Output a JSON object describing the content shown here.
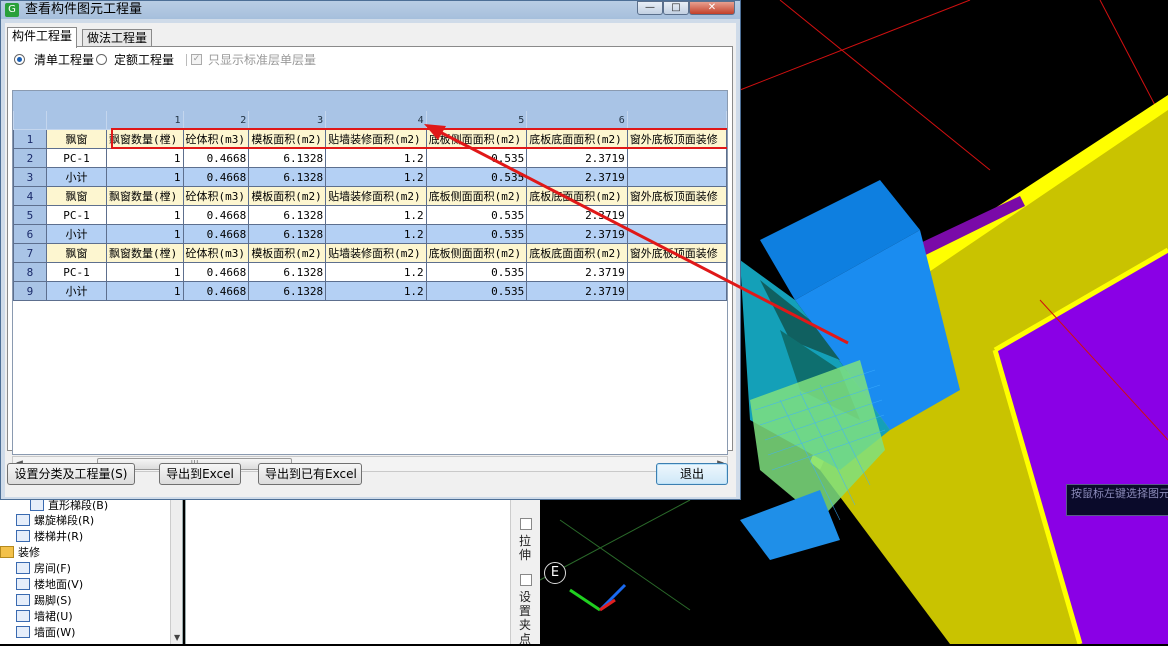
{
  "dialog": {
    "title": "查看构件图元工程量",
    "tabs": [
      {
        "label": "构件工程量",
        "active": true
      },
      {
        "label": "做法工程量",
        "active": false
      }
    ],
    "options": {
      "radio_list": "清单工程量",
      "radio_quota": "定额工程量",
      "check_std_floor": "只显示标准层单层量",
      "selected": "清单工程量"
    },
    "grid": {
      "column_numbers": [
        "1",
        "2",
        "3",
        "4",
        "5",
        "6"
      ],
      "rows": [
        {
          "num": "1",
          "style": "cream",
          "cells": [
            "飘窗",
            "飘窗数量(樘)",
            "砼体积(m3)",
            "模板面积(m2)",
            "贴墙装修面积(m2)",
            "底板侧面面积(m2)",
            "底板底面面积(m2)",
            "窗外底板顶面装修"
          ]
        },
        {
          "num": "2",
          "style": "white",
          "cells": [
            "PC-1",
            "1",
            "0.4668",
            "6.1328",
            "1.2",
            "0.535",
            "2.3719",
            ""
          ]
        },
        {
          "num": "3",
          "style": "blue",
          "cells": [
            "小计",
            "1",
            "0.4668",
            "6.1328",
            "1.2",
            "0.535",
            "2.3719",
            ""
          ]
        },
        {
          "num": "4",
          "style": "cream",
          "cells": [
            "飘窗",
            "飘窗数量(樘)",
            "砼体积(m3)",
            "模板面积(m2)",
            "贴墙装修面积(m2)",
            "底板侧面面积(m2)",
            "底板底面面积(m2)",
            "窗外底板顶面装修"
          ]
        },
        {
          "num": "5",
          "style": "white",
          "cells": [
            "PC-1",
            "1",
            "0.4668",
            "6.1328",
            "1.2",
            "0.535",
            "2.3719",
            ""
          ]
        },
        {
          "num": "6",
          "style": "blue",
          "cells": [
            "小计",
            "1",
            "0.4668",
            "6.1328",
            "1.2",
            "0.535",
            "2.3719",
            ""
          ]
        },
        {
          "num": "7",
          "style": "cream",
          "cells": [
            "飘窗",
            "飘窗数量(樘)",
            "砼体积(m3)",
            "模板面积(m2)",
            "贴墙装修面积(m2)",
            "底板侧面面积(m2)",
            "底板底面面积(m2)",
            "窗外底板顶面装修"
          ]
        },
        {
          "num": "8",
          "style": "white",
          "cells": [
            "PC-1",
            "1",
            "0.4668",
            "6.1328",
            "1.2",
            "0.535",
            "2.3719",
            ""
          ]
        },
        {
          "num": "9",
          "style": "blue",
          "cells": [
            "小计",
            "1",
            "0.4668",
            "6.1328",
            "1.2",
            "0.535",
            "2.3719",
            ""
          ]
        }
      ]
    },
    "buttons": {
      "set_category": "设置分类及工程量(S)",
      "export_excel": "导出到Excel",
      "export_existing": "导出到已有Excel",
      "exit": "退出"
    },
    "window_buttons": {
      "minimize": "—",
      "maximize": "□",
      "close": "✕"
    }
  },
  "tree": {
    "items": [
      {
        "label": "直形梯段(B)",
        "type": "item"
      },
      {
        "label": "螺旋梯段(R)",
        "type": "item"
      },
      {
        "label": "楼梯井(R)",
        "type": "item"
      },
      {
        "label": "装修",
        "type": "folder"
      },
      {
        "label": "房间(F)",
        "type": "item"
      },
      {
        "label": "楼地面(V)",
        "type": "item"
      },
      {
        "label": "踢脚(S)",
        "type": "item"
      },
      {
        "label": "墙裙(U)",
        "type": "item"
      },
      {
        "label": "墙面(W)",
        "type": "item"
      }
    ]
  },
  "vertical_tools": {
    "stretch": "拉伸",
    "set_grip": "设置夹点"
  },
  "viewport": {
    "axis_label": "E",
    "status_tip": "按鼠标左键选择图元，按右键中止或ESC"
  },
  "colors": {
    "highlight": "#e01818",
    "header_blue": "#a9c4e6",
    "row_blue": "#b4d0f4",
    "row_cream": "#fdf6d0"
  }
}
